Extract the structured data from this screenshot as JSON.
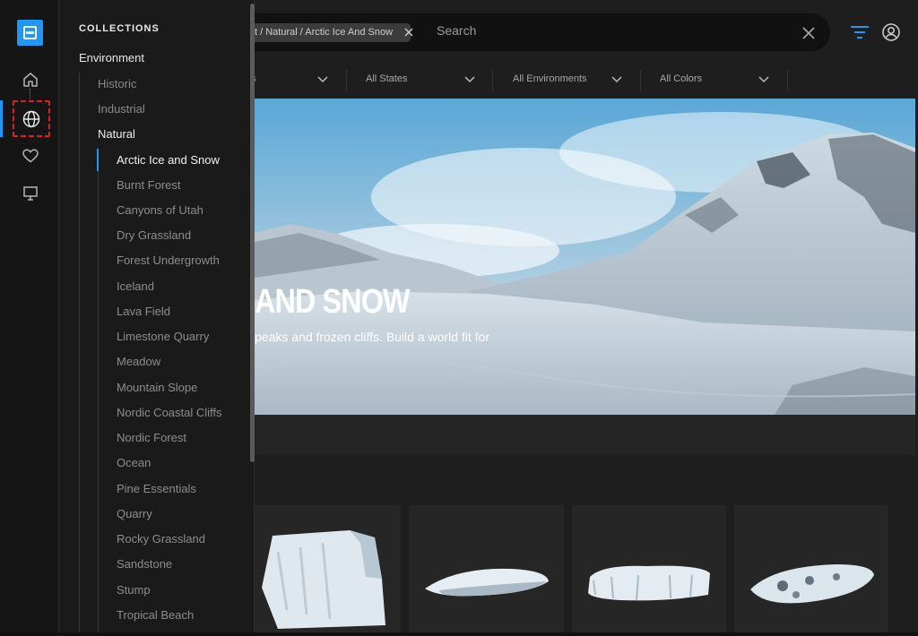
{
  "rail": {
    "items": [
      {
        "name": "home",
        "icon": "home-icon"
      },
      {
        "name": "environments",
        "icon": "globe-icon",
        "active": true
      },
      {
        "name": "favorites",
        "icon": "heart-icon"
      },
      {
        "name": "display",
        "icon": "monitor-icon"
      }
    ],
    "accent": "#2196f3"
  },
  "collections": {
    "title": "COLLECTIONS",
    "section": "Environment",
    "categories": [
      "Historic",
      "Industrial",
      "Natural"
    ],
    "active_category": "Natural",
    "subcategories": [
      "Arctic Ice and Snow",
      "Burnt Forest",
      "Canyons of Utah",
      "Dry Grassland",
      "Forest Undergrowth",
      "Iceland",
      "Lava Field",
      "Limestone Quarry",
      "Meadow",
      "Mountain Slope",
      "Nordic Coastal Cliffs",
      "Nordic Forest",
      "Ocean",
      "Pine Essentials",
      "Quarry",
      "Rocky Grassland",
      "Sandstone",
      "Stump",
      "Tropical Beach"
    ],
    "active_subcategory": "Arctic Ice and Snow"
  },
  "search": {
    "chip": "t / Natural / Arctic Ice And Snow",
    "placeholder": "Search"
  },
  "filters": {
    "first_suffix": "s",
    "items": [
      "All States",
      "All Environments",
      "All Colors"
    ]
  },
  "hero": {
    "title": "AND SNOW",
    "description": "peaks and frozen cliffs. Build a world fit for"
  }
}
